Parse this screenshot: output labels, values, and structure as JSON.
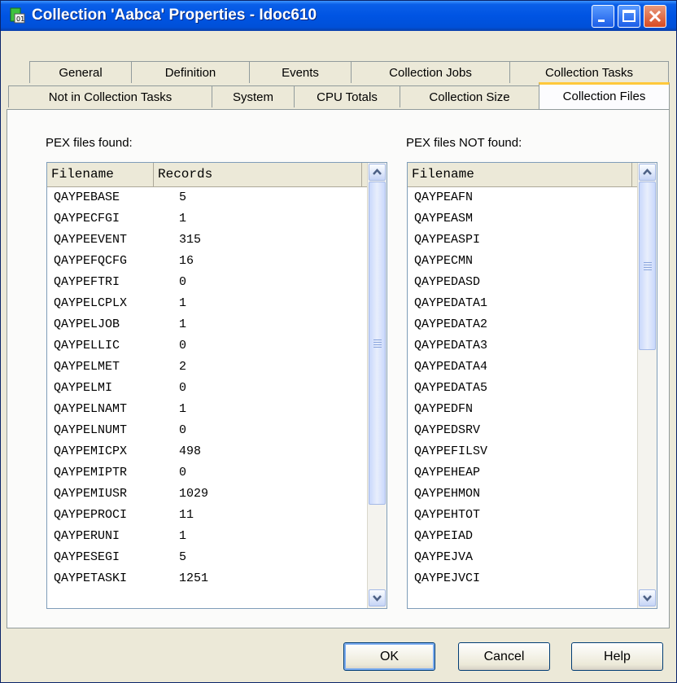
{
  "window": {
    "title": "Collection 'Aabca' Properties - Idoc610"
  },
  "tabs": {
    "row1": [
      "General",
      "Definition",
      "Events",
      "Collection Jobs",
      "Collection Tasks"
    ],
    "row2": [
      "Not in Collection Tasks",
      "System",
      "CPU Totals",
      "Collection Size",
      "Collection Files"
    ],
    "active": "Collection Files"
  },
  "found": {
    "label": "PEX files found:",
    "columns": [
      "Filename",
      "Records"
    ],
    "rows": [
      [
        "QAYPEBASE",
        "5"
      ],
      [
        "QAYPECFGI",
        "1"
      ],
      [
        "QAYPEEVENT",
        "315"
      ],
      [
        "QAYPEFQCFG",
        "16"
      ],
      [
        "QAYPEFTRI",
        "0"
      ],
      [
        "QAYPELCPLX",
        "1"
      ],
      [
        "QAYPELJOB",
        "1"
      ],
      [
        "QAYPELLIC",
        "0"
      ],
      [
        "QAYPELMET",
        "2"
      ],
      [
        "QAYPELMI",
        "0"
      ],
      [
        "QAYPELNAMT",
        "1"
      ],
      [
        "QAYPELNUMT",
        "0"
      ],
      [
        "QAYPEMICPX",
        "498"
      ],
      [
        "QAYPEMIPTR",
        "0"
      ],
      [
        "QAYPEMIUSR",
        "1029"
      ],
      [
        "QAYPEPROCI",
        "11"
      ],
      [
        "QAYPERUNI",
        "1"
      ],
      [
        "QAYPESEGI",
        "5"
      ],
      [
        "QAYPETASKI",
        "1251"
      ]
    ]
  },
  "not_found": {
    "label": "PEX files NOT found:",
    "columns": [
      "Filename"
    ],
    "rows": [
      "QAYPEAFN",
      "QAYPEASM",
      "QAYPEASPI",
      "QAYPECMN",
      "QAYPEDASD",
      "QAYPEDATA1",
      "QAYPEDATA2",
      "QAYPEDATA3",
      "QAYPEDATA4",
      "QAYPEDATA5",
      "QAYPEDFN",
      "QAYPEDSRV",
      "QAYPEFILSV",
      "QAYPEHEAP",
      "QAYPEHMON",
      "QAYPEHTOT",
      "QAYPEIAD",
      "QAYPEJVA",
      "QAYPEJVCI"
    ]
  },
  "buttons": {
    "ok": "OK",
    "cancel": "Cancel",
    "help": "Help"
  },
  "colors": {
    "titlebar": "#0054e3",
    "dialog_bg": "#ece9d8",
    "active_tab_accent": "#ffc83c"
  }
}
